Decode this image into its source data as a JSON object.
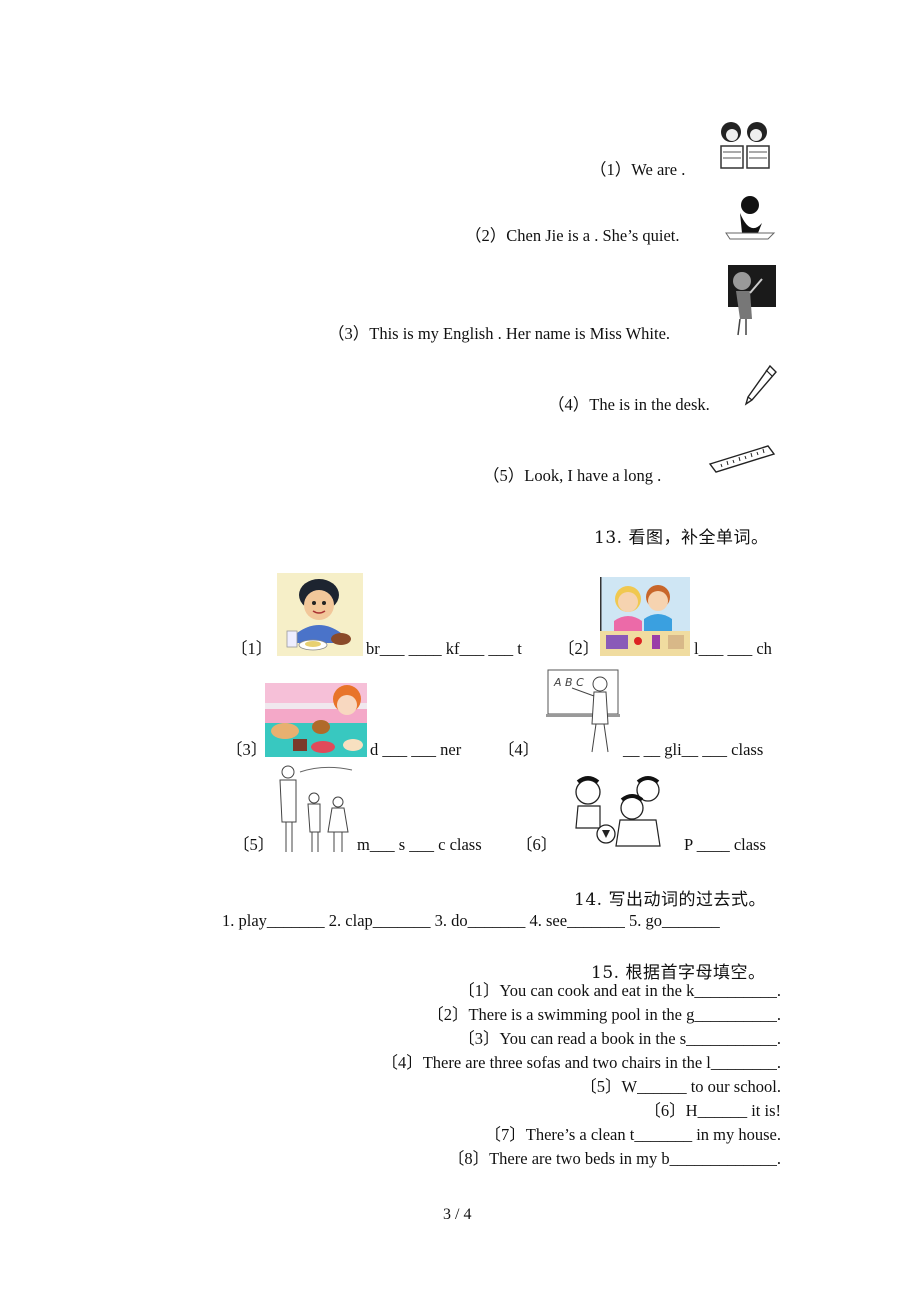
{
  "section12": {
    "items": [
      {
        "label": "（1）We are   .",
        "picture": "two-girls-friends"
      },
      {
        "label": "（2）Chen Jie is a   . She’s quiet.",
        "picture": "girl-student-drawing"
      },
      {
        "label": "（3）This is my English . Her name is Miss White.",
        "picture": "teacher-at-blackboard"
      },
      {
        "label": "（4）The is in the desk.",
        "picture": "pencil"
      },
      {
        "label": "（5）Look, I have a long   .",
        "picture": "ruler"
      }
    ]
  },
  "section13": {
    "title": "13.  看图，补全单词。",
    "items": [
      {
        "num": "〔1〕",
        "text": "br___ ____ kf___ ___ t",
        "picture": "boy-eating-breakfast"
      },
      {
        "num": "〔2〕",
        "text": "l___ ___ ch",
        "picture": "kids-eating-lunch"
      },
      {
        "num": "〔3〕",
        "text": "d ___ ___ ner",
        "picture": "girl-with-dinner-table"
      },
      {
        "num": "〔4〕",
        "text": "__ __ gli__ ___ class",
        "picture": "teacher-abc-blackboard"
      },
      {
        "num": "〔5〕",
        "text": "m___ s ___ c  class",
        "picture": "singing-class"
      },
      {
        "num": "〔6〕",
        "text": "P ____  class",
        "picture": "kids-playing-football"
      }
    ]
  },
  "section14": {
    "title": "14.  写出动词的过去式。",
    "line": "1. play_______ 2. clap_______ 3. do_______ 4. see_______ 5. go_______"
  },
  "section15": {
    "title": "15.  根据首字母填空。",
    "items": [
      "〔1〕You can cook and eat in the k__________.",
      "〔2〕There is a swimming pool in the g__________.",
      "〔3〕You can read a book in the s___________.",
      "〔4〕There are three sofas and two chairs in the l________.",
      "〔5〕W______ to our school.",
      "〔6〕H______ it is!",
      "〔7〕There’s a clean t_______ in my house.",
      "〔8〕There are two beds in my b_____________."
    ]
  },
  "footer": {
    "page_number": "3 / 4"
  }
}
